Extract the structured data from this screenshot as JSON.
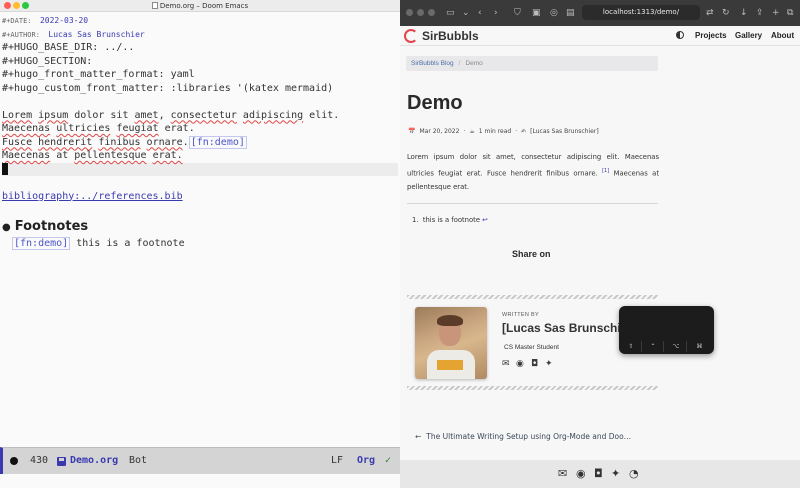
{
  "emacs": {
    "window_title": "Demo.org – Doom Emacs",
    "date_keyword": "#+DATE:",
    "date_value": "2022-03-20",
    "author_keyword": "#+AUTHOR:",
    "author_value": "Lucas Sas Brunschier",
    "line_base_dir": "#+HUGO_BASE_DIR: ../..",
    "line_section": "#+HUGO_SECTION:",
    "line_front_format": "#+hugo_front_matter_format: yaml",
    "line_custom_front": "#+hugo_custom_front_matter: :libraries '(katex mermaid)",
    "p1": {
      "w1": "Lorem",
      "w2": "ipsum",
      "w3": "dolor sit",
      "w4": "amet",
      "w5": ",",
      "w6": "consectetur",
      "w7": "adipiscing",
      "w8": "elit."
    },
    "p2": {
      "w1": "Maecenas",
      "w2": "ultricies",
      "w3": "feugiat",
      "w4": "erat."
    },
    "p3": {
      "w1": "Fusce",
      "w2": "hendrerit",
      "w3": "finibus",
      "w4": "ornare",
      "w5": ".",
      "fnref": "[fn:demo]"
    },
    "p4": {
      "w1": "Maecenas",
      "w2": "at",
      "w3": "pellentesque",
      "w4": "erat."
    },
    "bibliography": "bibliography:../references.bib",
    "footnotes_heading": "Footnotes",
    "footnote_ref": "[fn:demo]",
    "footnote_text": "this is a footnote",
    "modeline": {
      "size": "430",
      "filename": "Demo.org",
      "position": "Bot",
      "eol": "LF",
      "mode": "Org",
      "status": "✓"
    }
  },
  "browser": {
    "url": "localhost:1313/demo/",
    "brand": "SirBubbls",
    "nav": [
      "Projects",
      "Gallery",
      "About"
    ],
    "breadcrumb": {
      "parent": "SirBubbls Blog",
      "sep": "/",
      "current": "Demo"
    },
    "post": {
      "title": "Demo",
      "date": "Mar 20, 2022",
      "sep": "·",
      "read_time": "1 min read",
      "author": "[Lucas Sas Brunschier]",
      "body": "Lorem ipsum dolor sit amet, consectetur adipiscing elit. Maecenas ultricies feugiat erat. Fusce hendrerit finibus ornare.",
      "body_ref": "[1]",
      "body_end": "Maecenas at pellentesque erat.",
      "footnote_number": "1.",
      "footnote_text": "this is a footnote",
      "footnote_back": "↩",
      "share": "Share on"
    },
    "author_box": {
      "written_by": "WRITTEN BY",
      "name": "[Lucas Sas Brunschier]",
      "role": "CS Master Student"
    },
    "prev_post": "The Ultimate Writing Setup using Org-Mode and Doo…"
  },
  "overlay": {
    "keys": [
      "⇧",
      "⌃",
      "⌥",
      "⌘"
    ]
  }
}
